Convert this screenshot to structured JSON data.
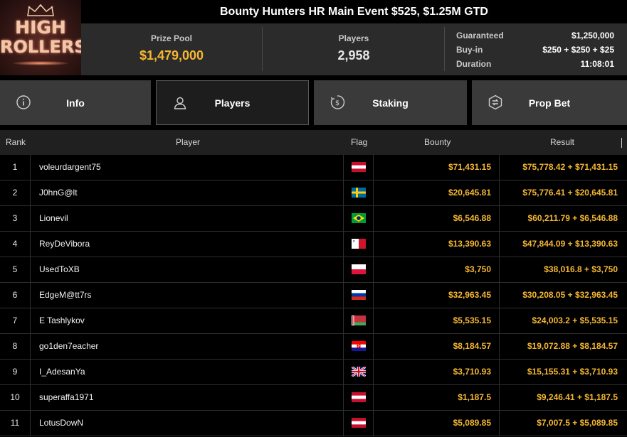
{
  "logo": {
    "line1": "HIGH",
    "line2": "ROLLERS"
  },
  "event": {
    "title": "Bounty Hunters HR Main Event $525, $1.25M GTD"
  },
  "stats": {
    "prize_pool_label": "Prize Pool",
    "prize_pool_value": "$1,479,000",
    "players_label": "Players",
    "players_value": "2,958",
    "guaranteed_label": "Guaranteed",
    "guaranteed_value": "$1,250,000",
    "buyin_label": "Buy-in",
    "buyin_value": "$250 + $250 + $25",
    "duration_label": "Duration",
    "duration_value": "11:08:01"
  },
  "tabs": [
    {
      "label": "Info",
      "icon": "info-icon"
    },
    {
      "label": "Players",
      "icon": "user-icon"
    },
    {
      "label": "Staking",
      "icon": "dollar-icon"
    },
    {
      "label": "Prop Bet",
      "icon": "prop-bet-icon"
    }
  ],
  "active_tab": "Players",
  "table": {
    "headers": {
      "rank": "Rank",
      "player": "Player",
      "flag": "Flag",
      "bounty": "Bounty",
      "result": "Result"
    },
    "rows": [
      {
        "rank": "1",
        "player": "voleurdargent75",
        "flag": "austria",
        "bounty": "$71,431.15",
        "result": "$75,778.42 + $71,431.15"
      },
      {
        "rank": "2",
        "player": "J0hnG@lt",
        "flag": "sweden",
        "bounty": "$20,645.81",
        "result": "$75,776.41 + $20,645.81"
      },
      {
        "rank": "3",
        "player": "Lionevil",
        "flag": "brazil",
        "bounty": "$6,546.88",
        "result": "$60,211.79 + $6,546.88"
      },
      {
        "rank": "4",
        "player": "ReyDeVibora",
        "flag": "malta",
        "bounty": "$13,390.63",
        "result": "$47,844.09 + $13,390.63"
      },
      {
        "rank": "5",
        "player": "UsedToXB",
        "flag": "poland",
        "bounty": "$3,750",
        "result": "$38,016.8 + $3,750"
      },
      {
        "rank": "6",
        "player": "EdgeM@tt7rs",
        "flag": "russia",
        "bounty": "$32,963.45",
        "result": "$30,208.05 + $32,963.45"
      },
      {
        "rank": "7",
        "player": "E Tashlykov",
        "flag": "belarus",
        "bounty": "$5,535.15",
        "result": "$24,003.2 + $5,535.15"
      },
      {
        "rank": "8",
        "player": "go1den7eacher",
        "flag": "croatia",
        "bounty": "$8,184.57",
        "result": "$19,072.88 + $8,184.57"
      },
      {
        "rank": "9",
        "player": "I_AdesanYa",
        "flag": "united-kingdom",
        "bounty": "$3,710.93",
        "result": "$15,155.31 + $3,710.93"
      },
      {
        "rank": "10",
        "player": "superaffa1971",
        "flag": "austria",
        "bounty": "$1,187.5",
        "result": "$9,246.41 + $1,187.5"
      },
      {
        "rank": "11",
        "player": "LotusDowN",
        "flag": "austria",
        "bounty": "$5,089.85",
        "result": "$7,007.5 + $5,089.85"
      }
    ]
  },
  "colors": {
    "accent_gold": "#f5b731",
    "panel": "#2b2b2b",
    "tab": "#3a3a3a"
  }
}
